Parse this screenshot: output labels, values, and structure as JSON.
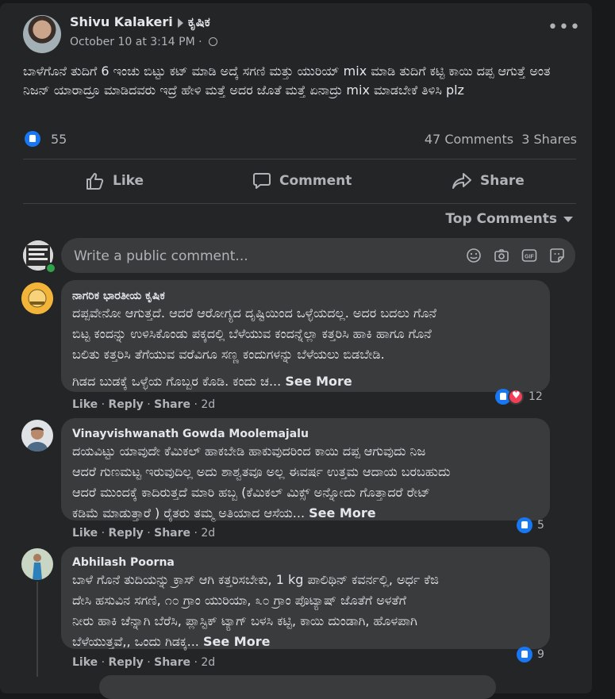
{
  "post": {
    "author": "Shivu Kalakeri",
    "group": "ಕೃಷಿಕ",
    "timestamp": "October 10 at 3:14 PM",
    "separator": "·",
    "more_icon": "more-horizontal-icon",
    "text": "ಬಾಳೆಗೊನೆ ತುದಿಗೆ 6 ಇಂಚು ಬಿಟ್ಟು ಕಟ್ ಮಾಡಿ ಅದ್ಕೆ ಸಗಣಿ ಮತ್ತು ಯುರಿಯ್ mix ಮಾಡಿ ತುದಿಗೆ ಕಟ್ಟಿ ಕಾಯಿ ದಪ್ಪ ಆಗುತ್ತೆ ಅಂತ ನಿಜನ್ ಯಾರಾದ್ರೂ ಮಾಡಿದವರು ಇದ್ರೆ ಹೇಳಿ ಮತ್ತೆ ಅದರ ಜೊತೆ ಮತ್ತೆ ಏನಾದ್ರು mix ಮಾಡಬೇಕೆ ತಿಳಿಸಿ plz",
    "reaction_count": "55",
    "comments_count": "47 Comments",
    "shares_count": "3 Shares"
  },
  "actions": {
    "like": "Like",
    "comment": "Comment",
    "share": "Share"
  },
  "sort": {
    "label": "Top Comments"
  },
  "composer": {
    "placeholder": "Write a public comment..."
  },
  "comments": [
    {
      "name": "ನಾಗರಿಕ ಭಾರತೀಯ ಕೃಷಿಕ",
      "lines": [
        "ದಪ್ಪವೇನೋ ಆಗುತ್ತದೆ. ಆದರೆ ಆರೋಗ್ಯದ ದೃಷ್ಟಿಯಿಂದ ಒಳ್ಳೆಯದಲ್ಲ. ಅದರ ಬದಲು ಗೊನೆ",
        "ಬಿಟ್ಟ ಕಂದನ್ನು ಉಳಿಸಿಕೊಂಡು ಪಕ್ಕದಲ್ಲಿ ಬೆಳೆಯುವ ಕಂದನ್ನೆಲ್ಲಾ ಕತ್ತರಿಸಿ ಹಾಕಿ ಹಾಗೂ ಗೊನೆ",
        "ಬಲಿತು ಕತ್ತರಿಸಿ ತೆಗೆಯುವ ವರೆವಿಗೂ ಸಣ್ಣ ಕಂದುಗಳನ್ನು ಬೆಳೆಯಲು ಬಿಡಬೇಡಿ."
      ],
      "extra": "ಗಿಡದ ಬುಡಕ್ಕೆ ಒಳ್ಳೆಯ ಗೊಬ್ಬರ ಕೊಡಿ. ಕಂದು ಚ...",
      "see_more": "See More",
      "like": "Like",
      "reply": "Reply",
      "share": "Share",
      "age": "2d",
      "reactions": "12"
    },
    {
      "name": "Vinayvishwanath Gowda Moolemajalu",
      "lines": [
        "ದಯವಿಟ್ಟು ಯಾವುದೇ ಕೆಮಿಕಲ್ ಹಾಕಬೇಡಿ ಹಾಕುವುದರಿಂದ ಕಾಯಿ ದಪ್ಪ ಆಗುವುದು ನಿಜ",
        "ಆದರೆ ಗುಣಮಟ್ಟ ಇರುವುದಿಲ್ಲ ಅದು ಶಾಶ್ವತವೂ ಅಲ್ಲ ಈವರ್ಷ ಉತ್ತಮ ಆದಾಯ ಬರಬಹುದು",
        "ಆದರೆ ಮುಂದಕ್ಕೆ ಕಾದಿರುತ್ತದೆ ಮಾರಿ ಹಬ್ಬ (ಕೆಮಿಕಲ್ ಮಿಕ್ಸ್ ಅನ್ನೋದು ಗೊತ್ತಾದರೆ ರೇಟ್"
      ],
      "extra": "ಕಡಿಮೆ ಮಾಡುತ್ತಾರೆ ) ರೈತರು ತಮ್ಮ ಅತಿಯಾದ ಆಸೆಯ...",
      "see_more": "See More",
      "like": "Like",
      "reply": "Reply",
      "share": "Share",
      "age": "2d",
      "reactions": "5"
    },
    {
      "name": "Abhilash Poorna",
      "lines": [
        "ಬಾಳೆ ಗೊನೆ ತುದಿಯನ್ನು ಕ್ರಾಸ್ ಆಗಿ ಕತ್ತರಿಸಬೇಕು, 1 kg ಪಾಲಿಥಿನ್ ಕವರ್ನಲ್ಲಿ, ಅರ್ಧ ಕೆಜಿ",
        "ದೇಸಿ ಹಸುವಿನ ಸಗಣಿ, ೧೦ ಗ್ರಾಂ ಯುರಿಯಾ, ೩೦ ಗ್ರಾಂ ಪೊಟ್ಯಾಷ್ ಜೊತೆಗೆ ಅಳತೆಗೆ",
        "ನೀರು ಹಾಕಿ ಚೆನ್ನಾಗಿ ಬೆರೆಸಿ, ಪ್ಲಾಸ್ಟಿಕ್ ಟ್ಯಾಗ್ ಬಳಸಿ ಕಟ್ಟಿ, ಕಾಯಿ ದುಂಡಾಗಿ, ಹೊಳಪಾಗಿ"
      ],
      "extra": "ಬೆಳೆಯುತ್ತವೆ,, ಒಂದು ಗಿಡಕ್ಕ...",
      "see_more": "See More",
      "like": "Like",
      "reply": "Reply",
      "share": "Share",
      "age": "2d",
      "reactions": "9"
    }
  ],
  "icons": {
    "like": "thumbs-up-icon",
    "comment": "speech-bubble-icon",
    "share": "share-arrow-icon",
    "emoji": "smiley-icon",
    "camera": "camera-icon",
    "gif": "gif-icon",
    "sticker": "sticker-icon"
  },
  "colors": {
    "background": "#18191a",
    "card": "#242526",
    "bubble": "#3a3b3c",
    "text": "#e4e6eb",
    "secondary": "#b0b3b8",
    "like_blue": "#1877f2",
    "love_red": "#f33e58",
    "online_green": "#31a24c"
  }
}
